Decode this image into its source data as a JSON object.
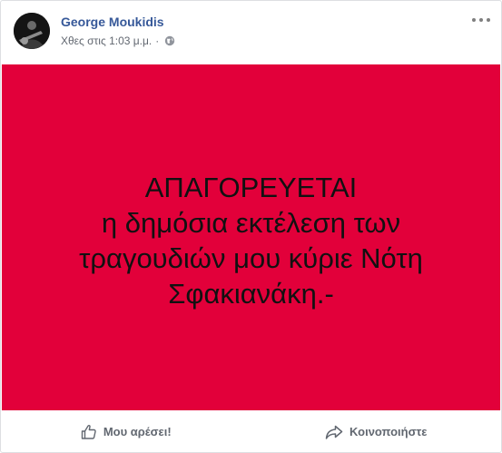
{
  "post": {
    "author": "George Moukidis",
    "timestamp": "Χθες στις 1:03 μ.μ.",
    "separator": "·",
    "privacy_icon": "globe-icon",
    "more_icon": "more-dots-icon",
    "banner": {
      "background": "#e2003a",
      "lines": [
        "ΑΠΑΓΟΡΕΥΕΤΑΙ",
        "η δημόσια εκτέλεση των",
        "τραγουδιών μου κύριε Νότη",
        "Σφακιανάκη.-"
      ]
    },
    "actions": {
      "like": {
        "label": "Μου αρέσει!",
        "icon": "thumbs-up-icon"
      },
      "share": {
        "label": "Κοινοποιήστε",
        "icon": "share-arrow-icon"
      }
    }
  },
  "colors": {
    "author": "#365899",
    "meta": "#616770",
    "banner": "#e2003a"
  }
}
